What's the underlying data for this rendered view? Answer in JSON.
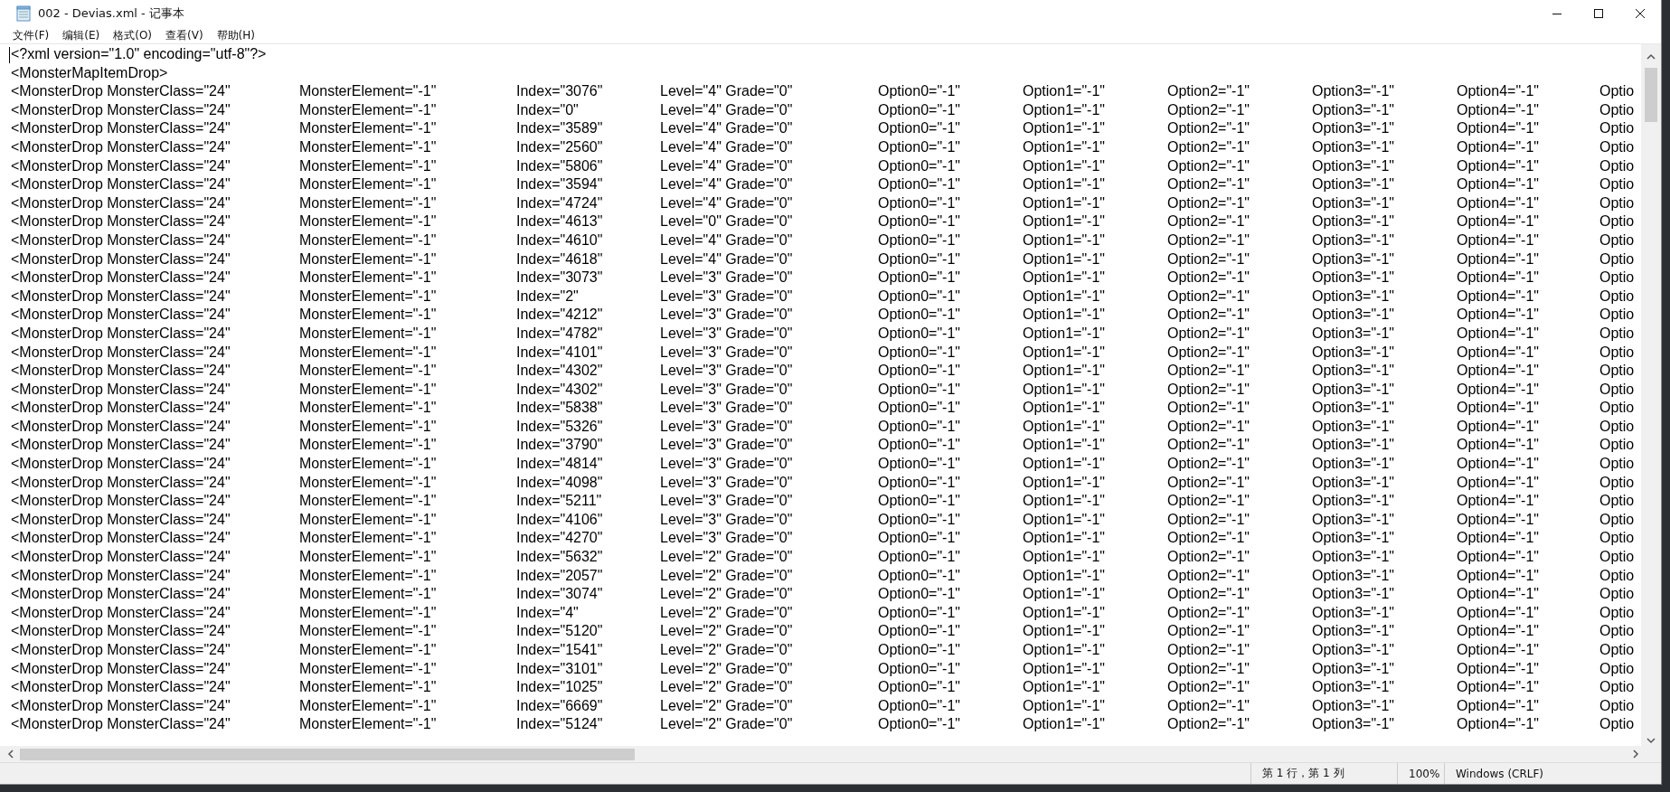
{
  "window": {
    "title": "002 - Devias.xml - 记事本"
  },
  "menu": [
    "文件(F)",
    "编辑(E)",
    "格式(O)",
    "查看(V)",
    "帮助(H)"
  ],
  "editor": {
    "header_lines": [
      "<?xml version=\"1.0\" encoding=\"utf-8\"?>",
      "<MonsterMapItemDrop>"
    ],
    "rows": [
      {
        "cells": [
          "<MonsterDrop MonsterClass=\"24\"",
          "MonsterElement=\"-1\"",
          "Index=\"3076\"",
          "Level=\"4\" Grade=\"0\"",
          "Option0=\"-1\"",
          "Option1=\"-1\"",
          "Option2=\"-1\"",
          "Option3=\"-1\"",
          "Option4=\"-1\"",
          "Optio"
        ]
      },
      {
        "cells": [
          "<MonsterDrop MonsterClass=\"24\"",
          "MonsterElement=\"-1\"",
          "Index=\"0\"",
          "Level=\"4\" Grade=\"0\"",
          "Option0=\"-1\"",
          "Option1=\"-1\"",
          "Option2=\"-1\"",
          "Option3=\"-1\"",
          "Option4=\"-1\"",
          "Optio"
        ]
      },
      {
        "cells": [
          "<MonsterDrop MonsterClass=\"24\"",
          "MonsterElement=\"-1\"",
          "Index=\"3589\"",
          "Level=\"4\" Grade=\"0\"",
          "Option0=\"-1\"",
          "Option1=\"-1\"",
          "Option2=\"-1\"",
          "Option3=\"-1\"",
          "Option4=\"-1\"",
          "Optio"
        ]
      },
      {
        "cells": [
          "<MonsterDrop MonsterClass=\"24\"",
          "MonsterElement=\"-1\"",
          "Index=\"2560\"",
          "Level=\"4\" Grade=\"0\"",
          "Option0=\"-1\"",
          "Option1=\"-1\"",
          "Option2=\"-1\"",
          "Option3=\"-1\"",
          "Option4=\"-1\"",
          "Optio"
        ]
      },
      {
        "cells": [
          "<MonsterDrop MonsterClass=\"24\"",
          "MonsterElement=\"-1\"",
          "Index=\"5806\"",
          "Level=\"4\" Grade=\"0\"",
          "Option0=\"-1\"",
          "Option1=\"-1\"",
          "Option2=\"-1\"",
          "Option3=\"-1\"",
          "Option4=\"-1\"",
          "Optio"
        ]
      },
      {
        "cells": [
          "<MonsterDrop MonsterClass=\"24\"",
          "MonsterElement=\"-1\"",
          "Index=\"3594\"",
          "Level=\"4\" Grade=\"0\"",
          "Option0=\"-1\"",
          "Option1=\"-1\"",
          "Option2=\"-1\"",
          "Option3=\"-1\"",
          "Option4=\"-1\"",
          "Optio"
        ]
      },
      {
        "cells": [
          "<MonsterDrop MonsterClass=\"24\"",
          "MonsterElement=\"-1\"",
          "Index=\"4724\"",
          "Level=\"4\" Grade=\"0\"",
          "Option0=\"-1\"",
          "Option1=\"-1\"",
          "Option2=\"-1\"",
          "Option3=\"-1\"",
          "Option4=\"-1\"",
          "Optio"
        ]
      },
      {
        "cells": [
          "<MonsterDrop MonsterClass=\"24\"",
          "MonsterElement=\"-1\"",
          "Index=\"4613\"",
          "Level=\"0\" Grade=\"0\"",
          "Option0=\"-1\"",
          "Option1=\"-1\"",
          "Option2=\"-1\"",
          "Option3=\"-1\"",
          "Option4=\"-1\"",
          "Optio"
        ]
      },
      {
        "cells": [
          "<MonsterDrop MonsterClass=\"24\"",
          "MonsterElement=\"-1\"",
          "Index=\"4610\"",
          "Level=\"4\" Grade=\"0\"",
          "Option0=\"-1\"",
          "Option1=\"-1\"",
          "Option2=\"-1\"",
          "Option3=\"-1\"",
          "Option4=\"-1\"",
          "Optio"
        ]
      },
      {
        "cells": [
          "<MonsterDrop MonsterClass=\"24\"",
          "MonsterElement=\"-1\"",
          "Index=\"4618\"",
          "Level=\"4\" Grade=\"0\"",
          "Option0=\"-1\"",
          "Option1=\"-1\"",
          "Option2=\"-1\"",
          "Option3=\"-1\"",
          "Option4=\"-1\"",
          "Optio"
        ]
      },
      {
        "cells": [
          "<MonsterDrop MonsterClass=\"24\"",
          "MonsterElement=\"-1\"",
          "Index=\"3073\"",
          "Level=\"3\" Grade=\"0\"",
          "Option0=\"-1\"",
          "Option1=\"-1\"",
          "Option2=\"-1\"",
          "Option3=\"-1\"",
          "Option4=\"-1\"",
          "Optio"
        ]
      },
      {
        "cells": [
          "<MonsterDrop MonsterClass=\"24\"",
          "MonsterElement=\"-1\"",
          "Index=\"2\"",
          "Level=\"3\" Grade=\"0\"",
          "Option0=\"-1\"",
          "Option1=\"-1\"",
          "Option2=\"-1\"",
          "Option3=\"-1\"",
          "Option4=\"-1\"",
          "Optio"
        ]
      },
      {
        "cells": [
          "<MonsterDrop MonsterClass=\"24\"",
          "MonsterElement=\"-1\"",
          "Index=\"4212\"",
          "Level=\"3\" Grade=\"0\"",
          "Option0=\"-1\"",
          "Option1=\"-1\"",
          "Option2=\"-1\"",
          "Option3=\"-1\"",
          "Option4=\"-1\"",
          "Optio"
        ]
      },
      {
        "cells": [
          "<MonsterDrop MonsterClass=\"24\"",
          "MonsterElement=\"-1\"",
          "Index=\"4782\"",
          "Level=\"3\" Grade=\"0\"",
          "Option0=\"-1\"",
          "Option1=\"-1\"",
          "Option2=\"-1\"",
          "Option3=\"-1\"",
          "Option4=\"-1\"",
          "Optio"
        ]
      },
      {
        "cells": [
          "<MonsterDrop MonsterClass=\"24\"",
          "MonsterElement=\"-1\"",
          "Index=\"4101\"",
          "Level=\"3\" Grade=\"0\"",
          "Option0=\"-1\"",
          "Option1=\"-1\"",
          "Option2=\"-1\"",
          "Option3=\"-1\"",
          "Option4=\"-1\"",
          "Optio"
        ]
      },
      {
        "cells": [
          "<MonsterDrop MonsterClass=\"24\"",
          "MonsterElement=\"-1\"",
          "Index=\"4302\"",
          "Level=\"3\" Grade=\"0\"",
          "Option0=\"-1\"",
          "Option1=\"-1\"",
          "Option2=\"-1\"",
          "Option3=\"-1\"",
          "Option4=\"-1\"",
          "Optio"
        ]
      },
      {
        "cells": [
          "<MonsterDrop MonsterClass=\"24\"",
          "MonsterElement=\"-1\"",
          "Index=\"4302\"",
          "Level=\"3\" Grade=\"0\"",
          "Option0=\"-1\"",
          "Option1=\"-1\"",
          "Option2=\"-1\"",
          "Option3=\"-1\"",
          "Option4=\"-1\"",
          "Optio"
        ]
      },
      {
        "cells": [
          "<MonsterDrop MonsterClass=\"24\"",
          "MonsterElement=\"-1\"",
          "Index=\"5838\"",
          "Level=\"3\" Grade=\"0\"",
          "Option0=\"-1\"",
          "Option1=\"-1\"",
          "Option2=\"-1\"",
          "Option3=\"-1\"",
          "Option4=\"-1\"",
          "Optio"
        ]
      },
      {
        "cells": [
          "<MonsterDrop MonsterClass=\"24\"",
          "MonsterElement=\"-1\"",
          "Index=\"5326\"",
          "Level=\"3\" Grade=\"0\"",
          "Option0=\"-1\"",
          "Option1=\"-1\"",
          "Option2=\"-1\"",
          "Option3=\"-1\"",
          "Option4=\"-1\"",
          "Optio"
        ]
      },
      {
        "cells": [
          "<MonsterDrop MonsterClass=\"24\"",
          "MonsterElement=\"-1\"",
          "Index=\"3790\"",
          "Level=\"3\" Grade=\"0\"",
          "Option0=\"-1\"",
          "Option1=\"-1\"",
          "Option2=\"-1\"",
          "Option3=\"-1\"",
          "Option4=\"-1\"",
          "Optio"
        ]
      },
      {
        "cells": [
          "<MonsterDrop MonsterClass=\"24\"",
          "MonsterElement=\"-1\"",
          "Index=\"4814\"",
          "Level=\"3\" Grade=\"0\"",
          "Option0=\"-1\"",
          "Option1=\"-1\"",
          "Option2=\"-1\"",
          "Option3=\"-1\"",
          "Option4=\"-1\"",
          "Optio"
        ]
      },
      {
        "cells": [
          "<MonsterDrop MonsterClass=\"24\"",
          "MonsterElement=\"-1\"",
          "Index=\"4098\"",
          "Level=\"3\" Grade=\"0\"",
          "Option0=\"-1\"",
          "Option1=\"-1\"",
          "Option2=\"-1\"",
          "Option3=\"-1\"",
          "Option4=\"-1\"",
          "Optio"
        ]
      },
      {
        "cells": [
          "<MonsterDrop MonsterClass=\"24\"",
          "MonsterElement=\"-1\"",
          "Index=\"5211\"",
          "Level=\"3\" Grade=\"0\"",
          "Option0=\"-1\"",
          "Option1=\"-1\"",
          "Option2=\"-1\"",
          "Option3=\"-1\"",
          "Option4=\"-1\"",
          "Optio"
        ]
      },
      {
        "cells": [
          "<MonsterDrop MonsterClass=\"24\"",
          "MonsterElement=\"-1\"",
          "Index=\"4106\"",
          "Level=\"3\" Grade=\"0\"",
          "Option0=\"-1\"",
          "Option1=\"-1\"",
          "Option2=\"-1\"",
          "Option3=\"-1\"",
          "Option4=\"-1\"",
          "Optio"
        ]
      },
      {
        "cells": [
          "<MonsterDrop MonsterClass=\"24\"",
          "MonsterElement=\"-1\"",
          "Index=\"4270\"",
          "Level=\"3\" Grade=\"0\"",
          "Option0=\"-1\"",
          "Option1=\"-1\"",
          "Option2=\"-1\"",
          "Option3=\"-1\"",
          "Option4=\"-1\"",
          "Optio"
        ]
      },
      {
        "cells": [
          "<MonsterDrop MonsterClass=\"24\"",
          "MonsterElement=\"-1\"",
          "Index=\"5632\"",
          "Level=\"2\" Grade=\"0\"",
          "Option0=\"-1\"",
          "Option1=\"-1\"",
          "Option2=\"-1\"",
          "Option3=\"-1\"",
          "Option4=\"-1\"",
          "Optio"
        ]
      },
      {
        "cells": [
          "<MonsterDrop MonsterClass=\"24\"",
          "MonsterElement=\"-1\"",
          "Index=\"2057\"",
          "Level=\"2\" Grade=\"0\"",
          "Option0=\"-1\"",
          "Option1=\"-1\"",
          "Option2=\"-1\"",
          "Option3=\"-1\"",
          "Option4=\"-1\"",
          "Optio"
        ]
      },
      {
        "cells": [
          "<MonsterDrop MonsterClass=\"24\"",
          "MonsterElement=\"-1\"",
          "Index=\"3074\"",
          "Level=\"2\" Grade=\"0\"",
          "Option0=\"-1\"",
          "Option1=\"-1\"",
          "Option2=\"-1\"",
          "Option3=\"-1\"",
          "Option4=\"-1\"",
          "Optio"
        ]
      },
      {
        "cells": [
          "<MonsterDrop MonsterClass=\"24\"",
          "MonsterElement=\"-1\"",
          "Index=\"4\"",
          "Level=\"2\" Grade=\"0\"",
          "Option0=\"-1\"",
          "Option1=\"-1\"",
          "Option2=\"-1\"",
          "Option3=\"-1\"",
          "Option4=\"-1\"",
          "Optio"
        ]
      },
      {
        "cells": [
          "<MonsterDrop MonsterClass=\"24\"",
          "MonsterElement=\"-1\"",
          "Index=\"5120\"",
          "Level=\"2\" Grade=\"0\"",
          "Option0=\"-1\"",
          "Option1=\"-1\"",
          "Option2=\"-1\"",
          "Option3=\"-1\"",
          "Option4=\"-1\"",
          "Optio"
        ]
      },
      {
        "cells": [
          "<MonsterDrop MonsterClass=\"24\"",
          "MonsterElement=\"-1\"",
          "Index=\"1541\"",
          "Level=\"2\" Grade=\"0\"",
          "Option0=\"-1\"",
          "Option1=\"-1\"",
          "Option2=\"-1\"",
          "Option3=\"-1\"",
          "Option4=\"-1\"",
          "Optio"
        ]
      },
      {
        "cells": [
          "<MonsterDrop MonsterClass=\"24\"",
          "MonsterElement=\"-1\"",
          "Index=\"3101\"",
          "Level=\"2\" Grade=\"0\"",
          "Option0=\"-1\"",
          "Option1=\"-1\"",
          "Option2=\"-1\"",
          "Option3=\"-1\"",
          "Option4=\"-1\"",
          "Optio"
        ]
      },
      {
        "cells": [
          "<MonsterDrop MonsterClass=\"24\"",
          "MonsterElement=\"-1\"",
          "Index=\"1025\"",
          "Level=\"2\" Grade=\"0\"",
          "Option0=\"-1\"",
          "Option1=\"-1\"",
          "Option2=\"-1\"",
          "Option3=\"-1\"",
          "Option4=\"-1\"",
          "Optio"
        ]
      },
      {
        "cells": [
          "<MonsterDrop MonsterClass=\"24\"",
          "MonsterElement=\"-1\"",
          "Index=\"6669\"",
          "Level=\"2\" Grade=\"0\"",
          "Option0=\"-1\"",
          "Option1=\"-1\"",
          "Option2=\"-1\"",
          "Option3=\"-1\"",
          "Option4=\"-1\"",
          "Optio"
        ]
      },
      {
        "cells": [
          "<MonsterDrop MonsterClass=\"24\"",
          "MonsterElement=\"-1\"",
          "Index=\"5124\"",
          "Level=\"2\" Grade=\"0\"",
          "Option0=\"-1\"",
          "Option1=\"-1\"",
          "Option2=\"-1\"",
          "Option3=\"-1\"",
          "Option4=\"-1\"",
          "Optio"
        ]
      }
    ]
  },
  "status_bar": {
    "position": "第 1 行，第 1 列",
    "zoom": "100%",
    "line_ending": "Windows (CRLF)"
  }
}
